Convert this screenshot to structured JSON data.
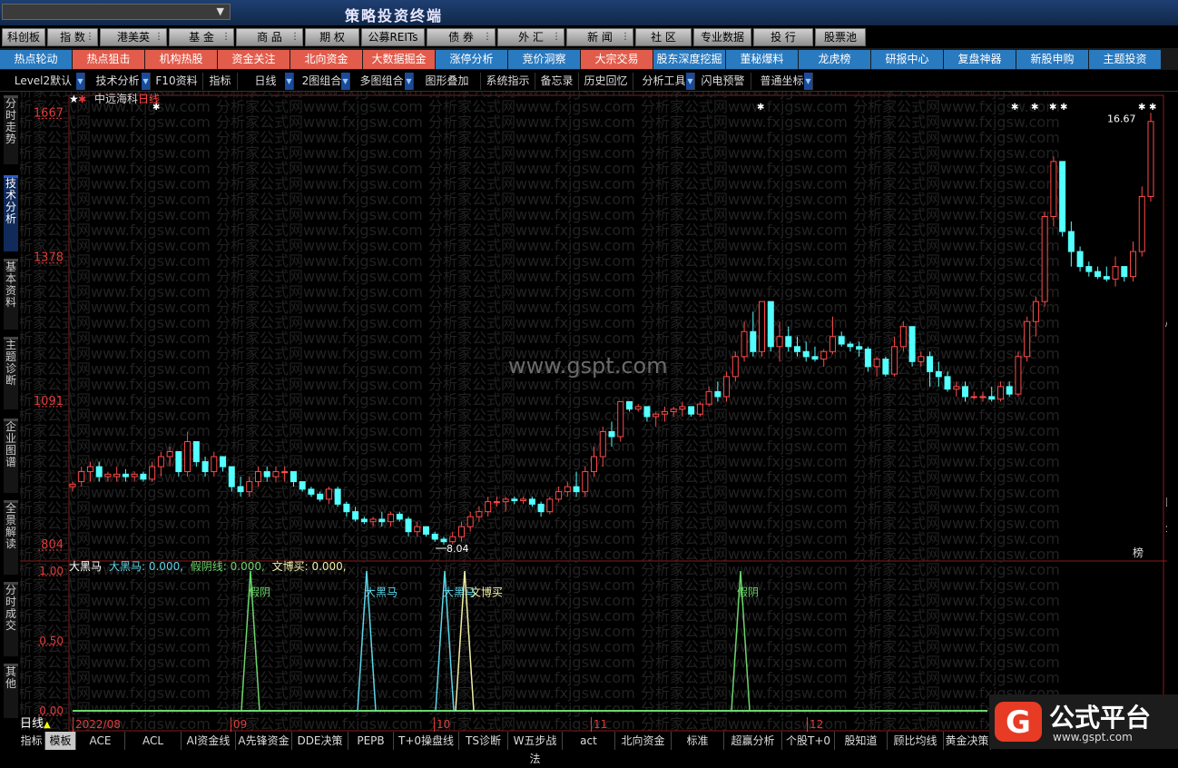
{
  "app": {
    "title": "策略投资终端",
    "selector_value": ""
  },
  "menu": [
    {
      "label": "科创板",
      "dot": false
    },
    {
      "label": "指 数",
      "dot": true
    },
    {
      "label": "港美英",
      "dot": true
    },
    {
      "label": "基 金",
      "dot": true
    },
    {
      "label": "商 品",
      "dot": true
    },
    {
      "label": "期 权",
      "dot": false
    },
    {
      "label": "公募REITs",
      "dot": false
    },
    {
      "label": "债 券",
      "dot": true
    },
    {
      "label": "外 汇",
      "dot": true
    },
    {
      "label": "新 闻",
      "dot": true
    },
    {
      "label": "社 区",
      "dot": false
    },
    {
      "label": "专业数据",
      "dot": false
    },
    {
      "label": "投 行",
      "dot": false
    },
    {
      "label": "股票池",
      "dot": false
    }
  ],
  "nav": [
    {
      "label": "热点轮动",
      "color": "#2a7ac0"
    },
    {
      "label": "热点狙击",
      "color": "#e25c4c"
    },
    {
      "label": "机构热股",
      "color": "#e25c4c"
    },
    {
      "label": "资金关注",
      "color": "#e25c4c"
    },
    {
      "label": "北向资金",
      "color": "#e25c4c"
    },
    {
      "label": "大数据掘金",
      "color": "#e25c4c"
    },
    {
      "label": "涨停分析",
      "color": "#2a7ac0"
    },
    {
      "label": "竞价洞察",
      "color": "#2a7ac0"
    },
    {
      "label": "大宗交易",
      "color": "#e25c4c"
    },
    {
      "label": "股东深度挖掘",
      "color": "#2a7ac0"
    },
    {
      "label": "董秘爆料",
      "color": "#2a7ac0"
    },
    {
      "label": "龙虎榜",
      "color": "#2a7ac0"
    },
    {
      "label": "研报中心",
      "color": "#2a7ac0"
    },
    {
      "label": "复盘神器",
      "color": "#2a7ac0"
    },
    {
      "label": "新股申购",
      "color": "#2a7ac0"
    },
    {
      "label": "主题投资",
      "color": "#2a7ac0"
    }
  ],
  "toolbar": [
    {
      "label": "Level2默认",
      "dd": true
    },
    {
      "label": "技术分析",
      "dd": true
    },
    {
      "label": "F10资料",
      "dd": false
    },
    {
      "label": "指标",
      "dd": false
    },
    {
      "label": "日线",
      "dd": true
    },
    {
      "label": "2图组合",
      "dd": true
    },
    {
      "label": "多图组合",
      "dd": true
    },
    {
      "label": "图形叠加",
      "dd": false
    },
    {
      "label": "系统指示",
      "dd": false
    },
    {
      "label": "备忘录",
      "dd": false
    },
    {
      "label": "历史回忆",
      "dd": false
    },
    {
      "label": "分析工具",
      "dd": true
    },
    {
      "label": "闪电预警",
      "dd": false
    },
    {
      "label": "普通坐标",
      "dd": true
    }
  ],
  "side_tabs": [
    {
      "label": "分时走势",
      "active": false
    },
    {
      "label": "技术分析",
      "active": true
    },
    {
      "label": "基本资料",
      "active": false
    },
    {
      "label": "主题诊断",
      "active": false
    },
    {
      "label": "企业图谱",
      "active": false
    },
    {
      "label": "全景解读",
      "active": false
    },
    {
      "label": "分时成交",
      "active": false
    },
    {
      "label": "其他",
      "active": false
    }
  ],
  "stock": {
    "name": "中远海科",
    "period": "日线"
  },
  "watermark": "www.gspt.com",
  "indicator": {
    "name": "大黑马",
    "values": [
      {
        "label": "大黑马:",
        "value": "0.000",
        "color": "#5dd6e8"
      },
      {
        "label": "假阴线:",
        "value": "0.000",
        "color": "#6bd66b"
      },
      {
        "label": "文博买:",
        "value": "0.000",
        "color": "#f0f0a8"
      }
    ],
    "axis": [
      "1.00",
      "0.50",
      "0.00"
    ]
  },
  "chart_data": {
    "type": "candlestick",
    "price_axis": [
      "16.67",
      "13.78",
      "10.91",
      "8.04"
    ],
    "ylim": [
      7.75,
      16.95
    ],
    "high_label": "16.67",
    "low_label": "8.04",
    "x_ticks": [
      "2022/08",
      "09",
      "10",
      "11",
      "12"
    ],
    "candles": [
      [
        9.2,
        9.3,
        9.1,
        9.25
      ],
      [
        9.3,
        9.6,
        9.2,
        9.5
      ],
      [
        9.5,
        9.7,
        9.3,
        9.6
      ],
      [
        9.6,
        9.7,
        9.3,
        9.4
      ],
      [
        9.4,
        9.5,
        9.3,
        9.45
      ],
      [
        9.4,
        9.6,
        9.3,
        9.45
      ],
      [
        9.45,
        9.55,
        9.3,
        9.4
      ],
      [
        9.4,
        9.5,
        9.3,
        9.45
      ],
      [
        9.45,
        9.5,
        9.3,
        9.35
      ],
      [
        9.35,
        9.7,
        9.3,
        9.6
      ],
      [
        9.6,
        9.9,
        9.4,
        9.8
      ],
      [
        9.8,
        10.0,
        9.6,
        9.9
      ],
      [
        9.9,
        9.9,
        9.4,
        9.5
      ],
      [
        9.5,
        10.3,
        9.4,
        10.1
      ],
      [
        10.1,
        10.1,
        9.6,
        9.7
      ],
      [
        9.7,
        9.8,
        9.4,
        9.5
      ],
      [
        9.5,
        9.9,
        9.4,
        9.8
      ],
      [
        9.8,
        9.8,
        9.5,
        9.6
      ],
      [
        9.6,
        9.6,
        9.1,
        9.2
      ],
      [
        9.2,
        9.4,
        9.0,
        9.1
      ],
      [
        9.1,
        9.4,
        9.0,
        9.3
      ],
      [
        9.3,
        9.6,
        9.2,
        9.5
      ],
      [
        9.5,
        9.6,
        9.3,
        9.4
      ],
      [
        9.4,
        9.6,
        9.3,
        9.5
      ],
      [
        9.5,
        9.6,
        9.3,
        9.5
      ],
      [
        9.5,
        9.5,
        9.2,
        9.3
      ],
      [
        9.3,
        9.3,
        9.1,
        9.15
      ],
      [
        9.15,
        9.2,
        9.0,
        9.05
      ],
      [
        9.05,
        9.1,
        8.9,
        8.95
      ],
      [
        8.95,
        9.2,
        8.85,
        9.15
      ],
      [
        9.15,
        9.2,
        8.8,
        8.85
      ],
      [
        8.85,
        8.9,
        8.6,
        8.7
      ],
      [
        8.7,
        8.8,
        8.5,
        8.55
      ],
      [
        8.55,
        8.6,
        8.45,
        8.5
      ],
      [
        8.5,
        8.6,
        8.4,
        8.55
      ],
      [
        8.55,
        8.7,
        8.4,
        8.5
      ],
      [
        8.5,
        8.7,
        8.4,
        8.65
      ],
      [
        8.65,
        8.7,
        8.5,
        8.55
      ],
      [
        8.55,
        8.6,
        8.2,
        8.3
      ],
      [
        8.3,
        8.5,
        8.2,
        8.4
      ],
      [
        8.4,
        8.4,
        8.2,
        8.25
      ],
      [
        8.25,
        8.3,
        8.1,
        8.15
      ],
      [
        8.15,
        8.2,
        8.04,
        8.1
      ],
      [
        8.1,
        8.3,
        8.05,
        8.2
      ],
      [
        8.2,
        8.5,
        8.1,
        8.4
      ],
      [
        8.4,
        8.7,
        8.3,
        8.6
      ],
      [
        8.6,
        8.8,
        8.5,
        8.7
      ],
      [
        8.7,
        9.0,
        8.6,
        8.9
      ],
      [
        8.9,
        9.0,
        8.8,
        8.9
      ],
      [
        8.9,
        9.0,
        8.7,
        8.95
      ],
      [
        8.95,
        9.0,
        8.85,
        8.92
      ],
      [
        8.92,
        9.0,
        8.85,
        8.95
      ],
      [
        8.95,
        9.0,
        8.8,
        8.85
      ],
      [
        8.85,
        8.9,
        8.6,
        8.7
      ],
      [
        8.7,
        9.0,
        8.65,
        8.95
      ],
      [
        8.95,
        9.2,
        8.9,
        9.1
      ],
      [
        9.1,
        9.3,
        9.0,
        9.2
      ],
      [
        9.2,
        9.5,
        9.0,
        9.1
      ],
      [
        9.1,
        9.6,
        9.0,
        9.5
      ],
      [
        9.5,
        10.0,
        9.4,
        9.8
      ],
      [
        9.8,
        10.4,
        9.6,
        10.3
      ],
      [
        10.3,
        10.5,
        10.0,
        10.2
      ],
      [
        10.2,
        10.8,
        10.1,
        10.9
      ],
      [
        10.9,
        10.9,
        10.7,
        10.75
      ],
      [
        10.75,
        10.85,
        10.7,
        10.8
      ],
      [
        10.8,
        10.8,
        10.5,
        10.6
      ],
      [
        10.6,
        10.7,
        10.4,
        10.65
      ],
      [
        10.65,
        10.8,
        10.5,
        10.7
      ],
      [
        10.7,
        10.8,
        10.6,
        10.75
      ],
      [
        10.75,
        10.9,
        10.6,
        10.8
      ],
      [
        10.8,
        10.8,
        10.6,
        10.65
      ],
      [
        10.65,
        10.9,
        10.6,
        10.85
      ],
      [
        10.85,
        11.2,
        10.8,
        11.1
      ],
      [
        11.1,
        11.3,
        10.9,
        11.0
      ],
      [
        11.0,
        11.5,
        10.9,
        11.4
      ],
      [
        11.4,
        11.9,
        11.3,
        11.8
      ],
      [
        11.8,
        12.5,
        11.7,
        12.3
      ],
      [
        12.3,
        12.7,
        11.8,
        11.9
      ],
      [
        11.9,
        12.9,
        11.8,
        12.9
      ],
      [
        12.9,
        12.9,
        11.9,
        12.0
      ],
      [
        12.0,
        12.5,
        11.7,
        12.2
      ],
      [
        12.2,
        12.4,
        11.9,
        12.0
      ],
      [
        12.0,
        12.2,
        11.8,
        11.9
      ],
      [
        11.9,
        12.1,
        11.7,
        11.8
      ],
      [
        11.8,
        12.0,
        11.7,
        11.75
      ],
      [
        11.75,
        11.95,
        11.6,
        11.9
      ],
      [
        11.9,
        12.6,
        11.85,
        12.2
      ],
      [
        12.2,
        12.3,
        12.0,
        12.05
      ],
      [
        12.05,
        12.1,
        11.9,
        12.0
      ],
      [
        12.0,
        12.1,
        11.8,
        11.95
      ],
      [
        11.95,
        12.0,
        11.5,
        11.6
      ],
      [
        11.6,
        11.8,
        11.4,
        11.75
      ],
      [
        11.75,
        11.8,
        11.4,
        11.45
      ],
      [
        11.45,
        12.2,
        11.4,
        12.0
      ],
      [
        12.0,
        12.5,
        11.9,
        12.4
      ],
      [
        12.4,
        12.4,
        11.6,
        11.7
      ],
      [
        11.7,
        11.9,
        11.6,
        11.8
      ],
      [
        11.8,
        11.9,
        11.2,
        11.5
      ],
      [
        11.5,
        11.7,
        11.2,
        11.4
      ],
      [
        11.4,
        11.5,
        11.1,
        11.15
      ],
      [
        11.15,
        11.3,
        11.0,
        11.2
      ],
      [
        11.2,
        11.3,
        10.9,
        11.0
      ],
      [
        11.0,
        11.1,
        10.95,
        11.0
      ],
      [
        11.0,
        11.1,
        10.9,
        11.0
      ],
      [
        11.0,
        11.2,
        10.9,
        10.95
      ],
      [
        10.95,
        11.3,
        10.9,
        11.2
      ],
      [
        11.2,
        11.3,
        11.0,
        11.05
      ],
      [
        11.05,
        11.9,
        11.0,
        11.8
      ],
      [
        11.8,
        12.6,
        11.7,
        12.5
      ],
      [
        12.5,
        13.0,
        12.2,
        12.9
      ],
      [
        12.9,
        14.7,
        12.8,
        14.6
      ],
      [
        14.6,
        15.8,
        14.4,
        15.7
      ],
      [
        15.7,
        15.7,
        14.2,
        14.3
      ],
      [
        14.3,
        14.5,
        13.6,
        13.9
      ],
      [
        13.9,
        14.0,
        13.5,
        13.6
      ],
      [
        13.6,
        13.7,
        13.4,
        13.5
      ],
      [
        13.5,
        13.6,
        13.35,
        13.4
      ],
      [
        13.4,
        13.6,
        13.3,
        13.35
      ],
      [
        13.35,
        13.8,
        13.2,
        13.6
      ],
      [
        13.6,
        13.6,
        13.3,
        13.4
      ],
      [
        13.4,
        14.1,
        13.3,
        13.9
      ],
      [
        13.9,
        15.2,
        13.8,
        15.0
      ],
      [
        15.0,
        16.67,
        14.9,
        16.5
      ]
    ]
  },
  "bottom_tabs": [
    "指标",
    "模板",
    "ACE",
    "ACL",
    "AI资金线",
    "A先锋资金",
    "DDE决策",
    "PEPB",
    "T+0操盘线",
    "TS诊断",
    "W五步战法",
    "act",
    "北向资金",
    "标准",
    "超赢分析",
    "个股T+0",
    "股知道",
    "顾比均线",
    "黄金决策"
  ],
  "date_tab": "日线",
  "brand": {
    "name": "公式平台",
    "url": "www.gspt.com"
  }
}
